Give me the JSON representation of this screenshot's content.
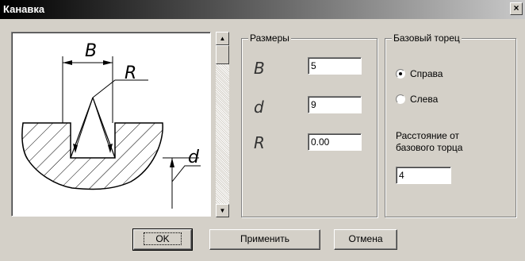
{
  "window": {
    "title": "Канавка",
    "close_glyph": "×"
  },
  "preview": {
    "labels": {
      "B": "B",
      "R": "R",
      "d": "d"
    }
  },
  "sizes": {
    "legend": "Размеры",
    "params": [
      {
        "label": "B",
        "value": "5"
      },
      {
        "label": "d",
        "value": "9"
      },
      {
        "label": "R",
        "value": "0.00"
      }
    ]
  },
  "base_face": {
    "legend": "Базовый торец",
    "options": [
      {
        "label": "Справа",
        "checked": true
      },
      {
        "label": "Слева",
        "checked": false
      }
    ],
    "distance_label_line1": "Расстояние от",
    "distance_label_line2": "базового торца",
    "distance_value": "4"
  },
  "buttons": {
    "ok": "OK",
    "apply": "Применить",
    "cancel": "Отмена"
  },
  "icons": {
    "scroll_up": "triangle-up-icon",
    "scroll_down": "triangle-down-icon"
  }
}
